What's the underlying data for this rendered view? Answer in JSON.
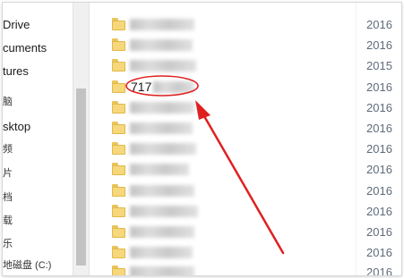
{
  "sidebar": {
    "items": [
      {
        "label": "Drive"
      },
      {
        "label": "cuments"
      },
      {
        "label": "tures"
      },
      {
        "label": "脑"
      },
      {
        "label": "sktop"
      },
      {
        "label": "频"
      },
      {
        "label": "片"
      },
      {
        "label": "档"
      },
      {
        "label": "载"
      },
      {
        "label": "乐"
      },
      {
        "label": "地磁盘 (C:)"
      }
    ]
  },
  "files": {
    "rows": [
      {
        "name": "",
        "date": "2016"
      },
      {
        "name": "",
        "date": "2016"
      },
      {
        "name": "",
        "date": "2015"
      },
      {
        "name": "717",
        "date": "2016"
      },
      {
        "name": "",
        "date": "2016"
      },
      {
        "name": "",
        "date": "2016"
      },
      {
        "name": "",
        "date": "2016"
      },
      {
        "name": "",
        "date": "2016"
      },
      {
        "name": "",
        "date": "2016"
      },
      {
        "name": "",
        "date": "2016"
      },
      {
        "name": "",
        "date": "2016"
      },
      {
        "name": "",
        "date": "2016"
      },
      {
        "name": "",
        "date": "2016"
      }
    ]
  },
  "colors": {
    "annotation": "#e02020",
    "folder": "#f6d77b",
    "date_text": "#5f6b7a"
  },
  "icons": {
    "folder": "folder-icon"
  }
}
